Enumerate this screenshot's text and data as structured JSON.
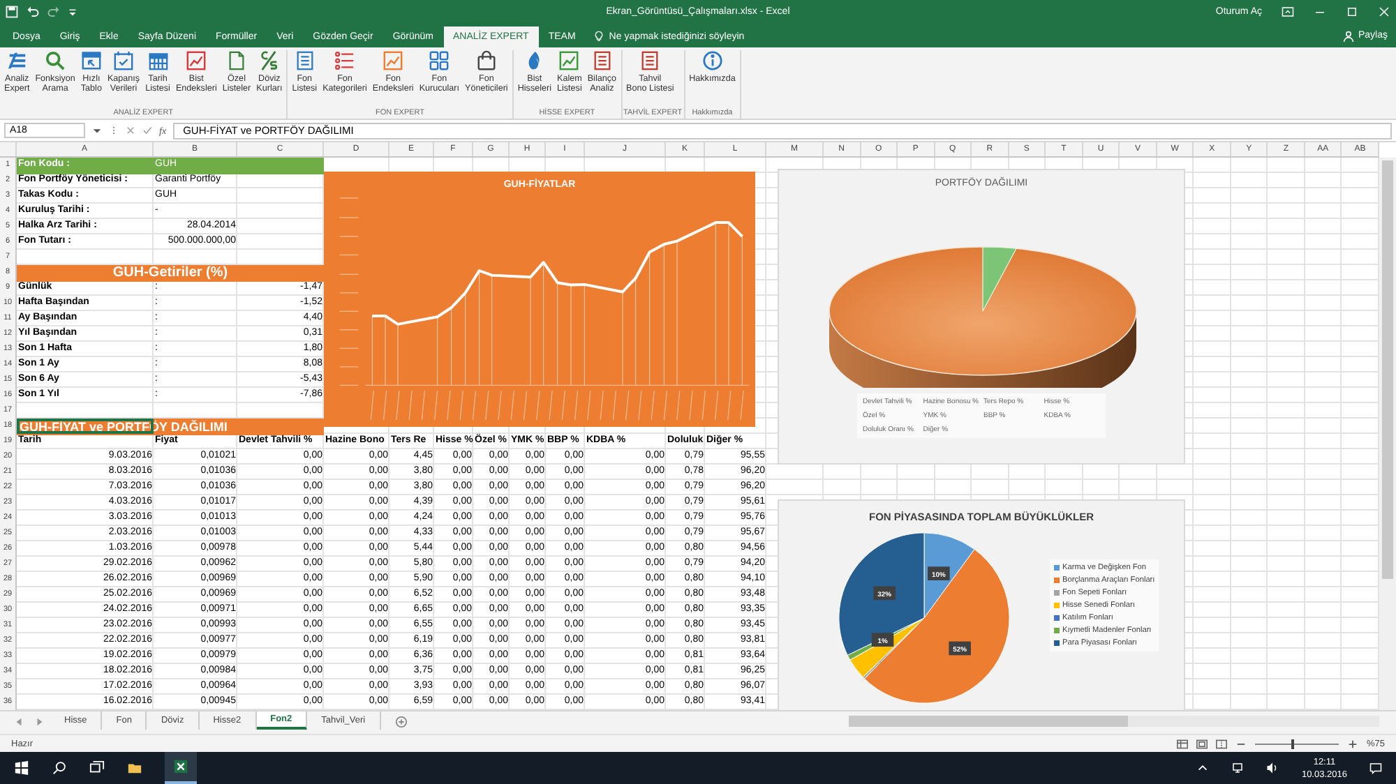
{
  "window": {
    "title": "Ekran_Görüntüsü_Çalışmaları.xlsx - Excel",
    "account": "Oturum Aç"
  },
  "tabs": [
    {
      "label": "Dosya",
      "selected": false
    },
    {
      "label": "Giriş",
      "selected": false
    },
    {
      "label": "Ekle",
      "selected": false
    },
    {
      "label": "Sayfa Düzeni",
      "selected": false
    },
    {
      "label": "Formüller",
      "selected": false
    },
    {
      "label": "Veri",
      "selected": false
    },
    {
      "label": "Gözden Geçir",
      "selected": false
    },
    {
      "label": "Görünüm",
      "selected": false
    },
    {
      "label": "ANALİZ EXPERT",
      "selected": true
    },
    {
      "label": "TEAM",
      "selected": false
    }
  ],
  "tell_me": {
    "placeholder": "Ne yapmak istediğinizi söyleyin"
  },
  "share": "Paylaş",
  "ribbon": [
    {
      "label": "ANALİZ EXPERT",
      "buttons": [
        {
          "label": "Analiz\nExpert"
        },
        {
          "label": "Fonksiyon\nArama"
        },
        {
          "label": "Hızlı\nTablo"
        },
        {
          "label": "Kapanış\nVerileri"
        },
        {
          "label": "Tarih\nListesi"
        },
        {
          "label": "Bist\nEndeksleri"
        },
        {
          "label": "Özel\nListeler"
        },
        {
          "label": "Döviz\nKurları"
        }
      ]
    },
    {
      "label": "FON EXPERT",
      "buttons": [
        {
          "label": "Fon\nListesi"
        },
        {
          "label": "Fon\nKategorileri"
        },
        {
          "label": "Fon\nEndeksleri"
        },
        {
          "label": "Fon\nKurucuları"
        },
        {
          "label": "Fon\nYöneticileri"
        }
      ]
    },
    {
      "label": "HİSSE EXPERT",
      "buttons": [
        {
          "label": "Bist\nHisseleri"
        },
        {
          "label": "Kalem\nListesi"
        },
        {
          "label": "Bilanço\nAnaliz"
        }
      ]
    },
    {
      "label": "TAHVİL EXPERT",
      "buttons": [
        {
          "label": "Tahvil\nBono Listesi"
        }
      ]
    },
    {
      "label": "Hakkımızda",
      "buttons": [
        {
          "label": "Hakkımızda"
        }
      ]
    }
  ],
  "formula_bar": {
    "name_box": "A18",
    "fx": "fx",
    "value": "GUH-FİYAT ve PORTFÖY DAĞILIMI"
  },
  "column_headers": [
    "A",
    "B",
    "C",
    "D",
    "E",
    "F",
    "G",
    "H",
    "I",
    "J",
    "K",
    "L",
    "M",
    "N",
    "O",
    "P",
    "Q",
    "R",
    "S",
    "T",
    "U",
    "V",
    "W",
    "X",
    "Y",
    "Z",
    "AA",
    "AB"
  ],
  "row_headers": [
    "1",
    "2",
    "3",
    "4",
    "5",
    "6",
    "7",
    "8",
    "9",
    "10",
    "11",
    "12",
    "13",
    "14",
    "15",
    "16",
    "17",
    "18",
    "19",
    "20",
    "21",
    "22",
    "23",
    "24",
    "25",
    "26",
    "27",
    "28",
    "29",
    "30",
    "31",
    "32",
    "33",
    "34",
    "35",
    "36"
  ],
  "fund_info": [
    {
      "label": "Fon Kodu :",
      "value": "GUH",
      "kind": "highlight"
    },
    {
      "label": "Fon Portföy Yöneticisi :",
      "value": "Garanti Portföy",
      "kind": "text"
    },
    {
      "label": "Takas Kodu :",
      "value": "GUH",
      "kind": "text"
    },
    {
      "label": "Kuruluş Tarihi :",
      "value": "-",
      "kind": "text"
    },
    {
      "label": "Halka Arz Tarihi :",
      "value": "28.04.2014",
      "kind": "number"
    },
    {
      "label": "Fon Tutarı :",
      "value": "500.000.000,00",
      "kind": "number"
    }
  ],
  "returns": {
    "title": "GUH-Getiriler (%)",
    "items": [
      {
        "label": "Günlük",
        "sep": ":",
        "value": "-1,47"
      },
      {
        "label": "Hafta Başından",
        "sep": ":",
        "value": "-1,52"
      },
      {
        "label": "Ay Başından",
        "sep": ":",
        "value": "4,40"
      },
      {
        "label": "Yıl Başından",
        "sep": ":",
        "value": "0,31"
      },
      {
        "label": "Son 1 Hafta",
        "sep": ":",
        "value": "1,80"
      },
      {
        "label": "Son 1 Ay",
        "sep": ":",
        "value": "8,08"
      },
      {
        "label": "Son 6 Ay",
        "sep": ":",
        "value": "-5,43"
      },
      {
        "label": "Son 1 Yıl",
        "sep": ":",
        "value": "-7,86"
      }
    ]
  },
  "table_title": {
    "text": "GUH-FİYAT ve PORTFÖY DAĞILIMI",
    "selected": true
  },
  "table": {
    "columns": [
      "Tarih",
      "Fiyat",
      "Devlet Tahvili %",
      "Hazine Bono",
      "Ters Re",
      "Hisse %",
      "Özel %",
      "YMK %",
      "BBP %",
      "KDBA %",
      "Doluluk",
      "Diğer %"
    ],
    "rows": [
      [
        "9.03.2016",
        "0,01021",
        "0,00",
        "0,00",
        "4,45",
        "0,00",
        "0,00",
        "0,00",
        "0,00",
        "0,00",
        "0,79",
        "95,55"
      ],
      [
        "8.03.2016",
        "0,01036",
        "0,00",
        "0,00",
        "3,80",
        "0,00",
        "0,00",
        "0,00",
        "0,00",
        "0,00",
        "0,78",
        "96,20"
      ],
      [
        "7.03.2016",
        "0,01036",
        "0,00",
        "0,00",
        "3,80",
        "0,00",
        "0,00",
        "0,00",
        "0,00",
        "0,00",
        "0,79",
        "96,20"
      ],
      [
        "4.03.2016",
        "0,01017",
        "0,00",
        "0,00",
        "4,39",
        "0,00",
        "0,00",
        "0,00",
        "0,00",
        "0,00",
        "0,79",
        "95,61"
      ],
      [
        "3.03.2016",
        "0,01013",
        "0,00",
        "0,00",
        "4,24",
        "0,00",
        "0,00",
        "0,00",
        "0,00",
        "0,00",
        "0,79",
        "95,76"
      ],
      [
        "2.03.2016",
        "0,01003",
        "0,00",
        "0,00",
        "4,33",
        "0,00",
        "0,00",
        "0,00",
        "0,00",
        "0,00",
        "0,79",
        "95,67"
      ],
      [
        "1.03.2016",
        "0,00978",
        "0,00",
        "0,00",
        "5,44",
        "0,00",
        "0,00",
        "0,00",
        "0,00",
        "0,00",
        "0,80",
        "94,56"
      ],
      [
        "29.02.2016",
        "0,00962",
        "0,00",
        "0,00",
        "5,80",
        "0,00",
        "0,00",
        "0,00",
        "0,00",
        "0,00",
        "0,79",
        "94,20"
      ],
      [
        "26.02.2016",
        "0,00969",
        "0,00",
        "0,00",
        "5,90",
        "0,00",
        "0,00",
        "0,00",
        "0,00",
        "0,00",
        "0,80",
        "94,10"
      ],
      [
        "25.02.2016",
        "0,00969",
        "0,00",
        "0,00",
        "6,52",
        "0,00",
        "0,00",
        "0,00",
        "0,00",
        "0,00",
        "0,80",
        "93,48"
      ],
      [
        "24.02.2016",
        "0,00971",
        "0,00",
        "0,00",
        "6,65",
        "0,00",
        "0,00",
        "0,00",
        "0,00",
        "0,00",
        "0,80",
        "93,35"
      ],
      [
        "23.02.2016",
        "0,00993",
        "0,00",
        "0,00",
        "6,55",
        "0,00",
        "0,00",
        "0,00",
        "0,00",
        "0,00",
        "0,80",
        "93,45"
      ],
      [
        "22.02.2016",
        "0,00977",
        "0,00",
        "0,00",
        "6,19",
        "0,00",
        "0,00",
        "0,00",
        "0,00",
        "0,00",
        "0,80",
        "93,81"
      ],
      [
        "19.02.2016",
        "0,00979",
        "0,00",
        "0,00",
        "6,36",
        "0,00",
        "0,00",
        "0,00",
        "0,00",
        "0,00",
        "0,81",
        "93,64"
      ],
      [
        "18.02.2016",
        "0,00984",
        "0,00",
        "0,00",
        "3,75",
        "0,00",
        "0,00",
        "0,00",
        "0,00",
        "0,00",
        "0,81",
        "96,25"
      ],
      [
        "17.02.2016",
        "0,00964",
        "0,00",
        "0,00",
        "3,93",
        "0,00",
        "0,00",
        "0,00",
        "0,00",
        "0,00",
        "0,80",
        "96,07"
      ],
      [
        "16.02.2016",
        "0,00945",
        "0,00",
        "0,00",
        "6,59",
        "0,00",
        "0,00",
        "0,00",
        "0,00",
        "0,00",
        "0,80",
        "93,41"
      ]
    ]
  },
  "price_chart": {
    "title": "GUH-FİYATLAR"
  },
  "portfolio_chart": {
    "title": "PORTFÖY DAĞILIMI",
    "legend": [
      "Devlet Tahvili %",
      "Hazine Bonosu %",
      "Ters Repo %",
      "Hisse %",
      "Özel %",
      "YMK %",
      "BBP %",
      "KDBA %",
      "Doluluk Oranı %",
      "Diğer %"
    ]
  },
  "market_chart": {
    "chart_data": {
      "type": "pie",
      "title": "FON PİYASASINDA TOPLAM BÜYÜKLÜKLER",
      "values": [
        10,
        52,
        0.4,
        4,
        null,
        1,
        32
      ],
      "value_labels": [
        "10%",
        "52%",
        null,
        null,
        null,
        "1%",
        "32%"
      ]
    },
    "legend": [
      {
        "label": "Karma ve Değişken Fon",
        "color": "#5b9bd5"
      },
      {
        "label": "Borçlanma Araçları Fonları",
        "color": "#ed7d31"
      },
      {
        "label": "Fon Sepeti Fonları",
        "color": "#a5a5a5"
      },
      {
        "label": "Hisse Senedi Fonları",
        "color": "#ffc000"
      },
      {
        "label": "Katılım Fonları",
        "color": "#4472c4"
      },
      {
        "label": "Kıymetli Madenler Fonları",
        "color": "#70ad47"
      },
      {
        "label": "Para Piyasası Fonları",
        "color": "#255e91"
      }
    ]
  },
  "sheet_tabs": [
    {
      "label": "Hisse",
      "selected": false
    },
    {
      "label": "Fon",
      "selected": false
    },
    {
      "label": "Döviz",
      "selected": false
    },
    {
      "label": "Hisse2",
      "selected": false
    },
    {
      "label": "Fon2",
      "selected": true
    },
    {
      "label": "Tahvil_Veri",
      "selected": false
    }
  ],
  "status_bar": {
    "status": "Hazır",
    "zoom": {
      "level": 0.45
    },
    "zoom_label": "%75"
  },
  "taskbar": {
    "time": "12:11",
    "date": "10.03.2016"
  }
}
